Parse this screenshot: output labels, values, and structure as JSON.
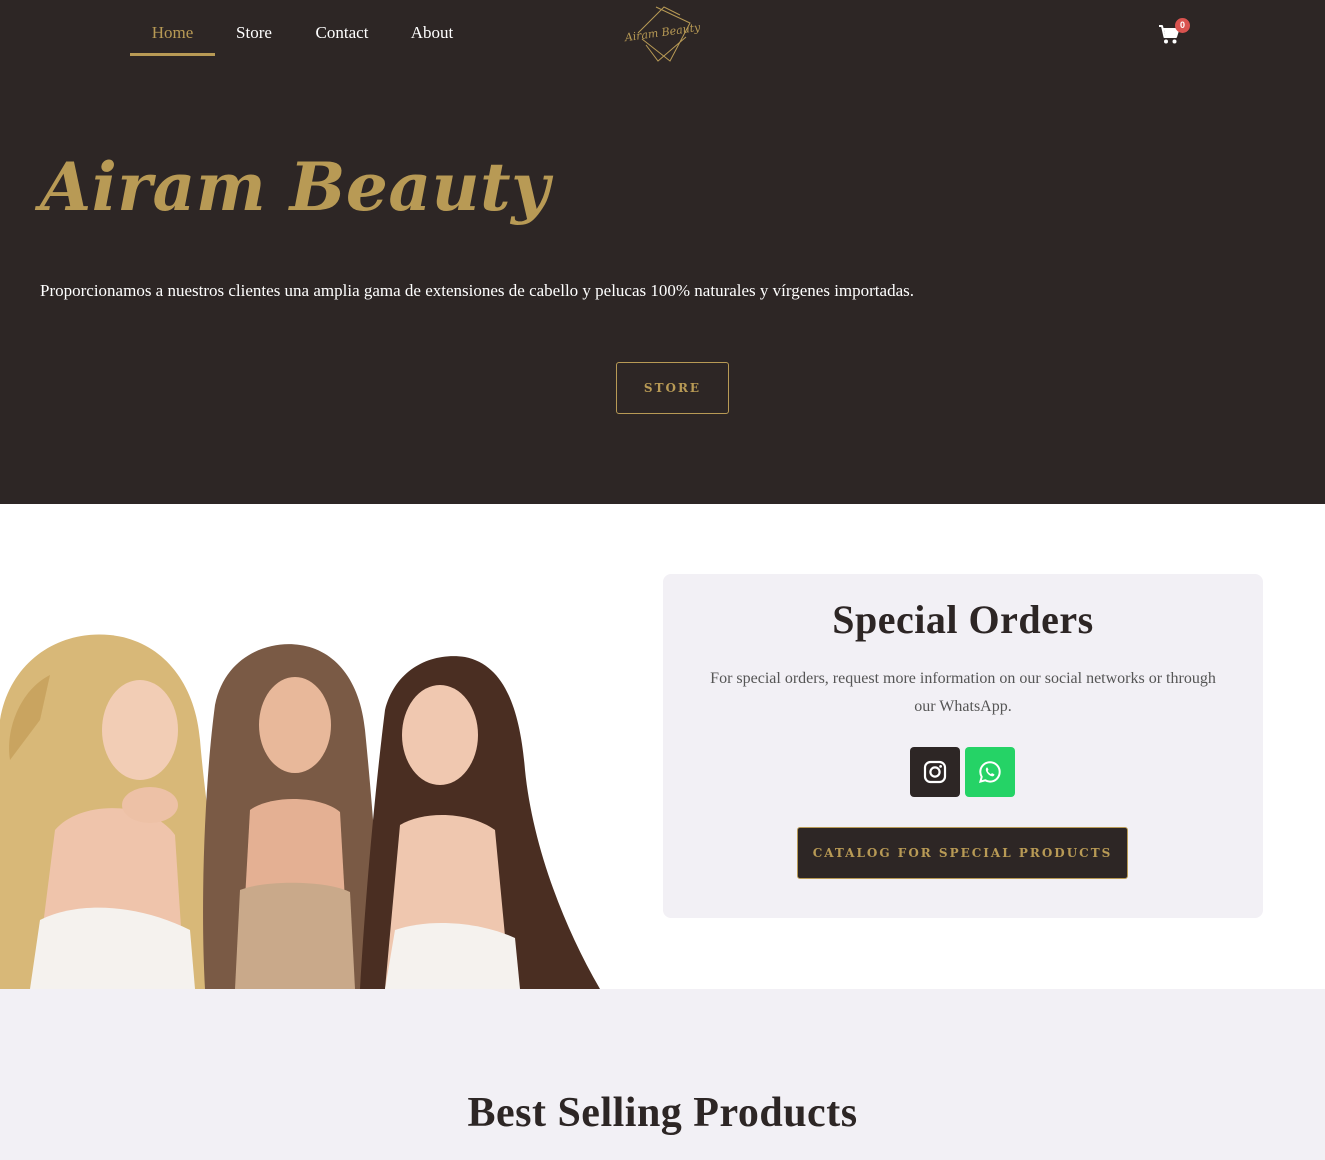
{
  "nav": {
    "items": [
      {
        "label": "Home",
        "active": true
      },
      {
        "label": "Store",
        "active": false
      },
      {
        "label": "Contact",
        "active": false
      },
      {
        "label": "About",
        "active": false
      }
    ],
    "logo_text": "Airam Beauty",
    "cart_count": "0",
    "cart_icon": "shopping-cart-icon"
  },
  "hero": {
    "title": "Airam Beauty",
    "text": "Proporcionamos a nuestros clientes una amplia gama de extensiones de cabello y pelucas 100% naturales y vírgenes importadas.",
    "button": "STORE"
  },
  "special": {
    "title": "Special Orders",
    "text": "For special orders, request more information on our social networks or through our WhatsApp.",
    "social": [
      {
        "icon": "instagram-icon",
        "color": "#2d2625"
      },
      {
        "icon": "whatsapp-icon",
        "color": "#25d366"
      }
    ],
    "button": "CATALOG FOR SPECIAL PRODUCTS"
  },
  "best": {
    "title": "Best Selling Products"
  },
  "colors": {
    "dark": "#2d2625",
    "gold": "#b89a55",
    "light_bg": "#f2f0f5",
    "whatsapp": "#25d366",
    "badge": "#d9534f"
  }
}
